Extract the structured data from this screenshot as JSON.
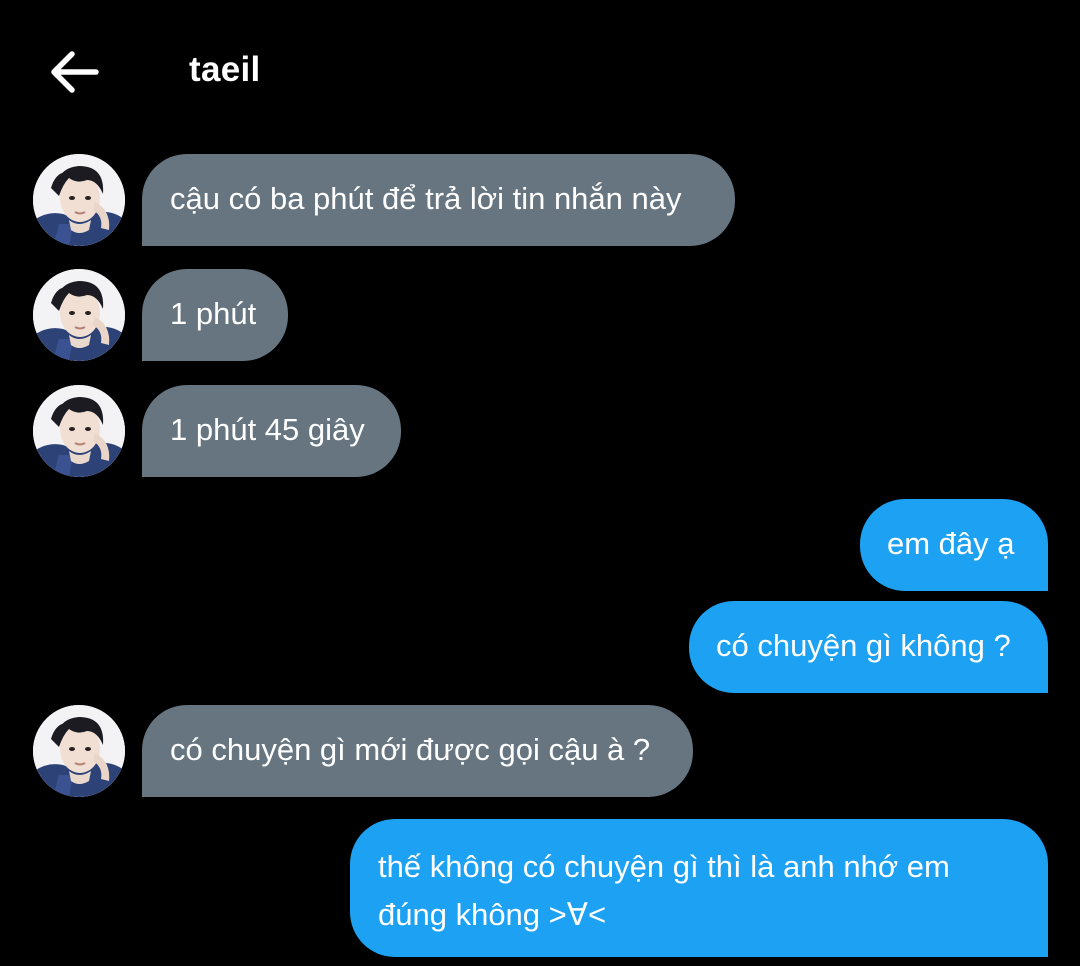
{
  "header": {
    "back_icon": "arrow-left-icon",
    "title": "taeil"
  },
  "contact": {
    "avatar_icon": "contact-avatar"
  },
  "colors": {
    "background": "#000000",
    "incoming_bubble": "#66757f",
    "outgoing_bubble": "#1da1f2",
    "text": "#ffffff"
  },
  "messages": [
    {
      "direction": "incoming",
      "text": "cậu có ba phút để trả lời tin nhắn này"
    },
    {
      "direction": "incoming",
      "text": "1 phút"
    },
    {
      "direction": "incoming",
      "text": "1 phút 45 giây"
    },
    {
      "direction": "outgoing",
      "text": "em đây ạ"
    },
    {
      "direction": "outgoing",
      "text": "có chuyện gì không ?"
    },
    {
      "direction": "incoming",
      "text": "có chuyện gì mới được gọi cậu à ?"
    },
    {
      "direction": "outgoing",
      "text": "thế không có chuyện gì thì là anh nhớ em đúng không >∀<"
    }
  ]
}
